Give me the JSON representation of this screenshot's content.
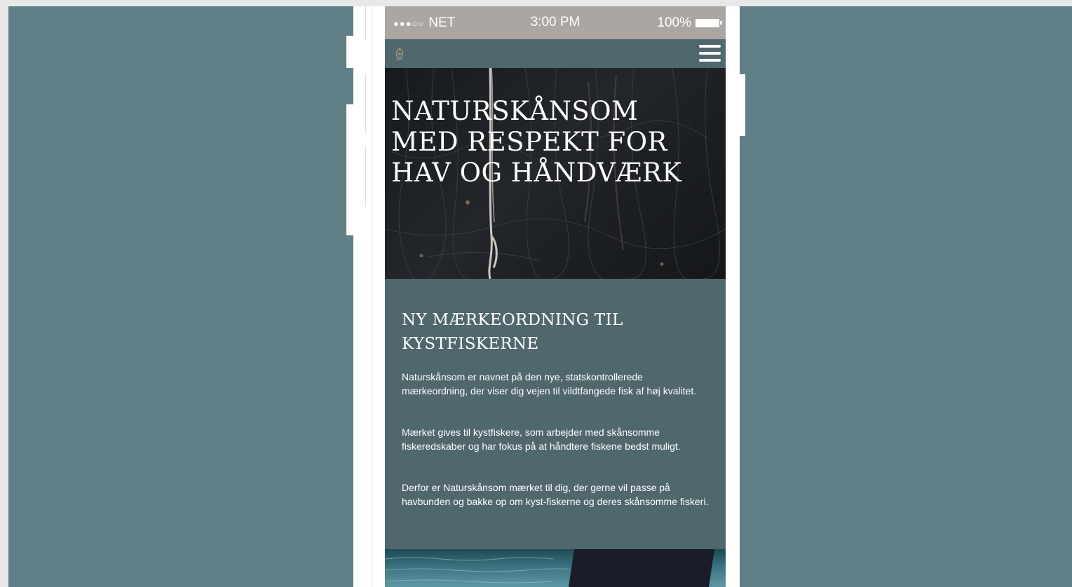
{
  "status_bar": {
    "signal": "●●●○○",
    "carrier": "NET",
    "time": "3:00 PM",
    "battery": "100%"
  },
  "navbar": {
    "logo_icon": "fish-emblem-icon",
    "menu_icon": "hamburger-menu-icon"
  },
  "hero": {
    "title": "NATURSKÅNSOM MED RESPEKT FOR HAV OG HÅNDVÆRK"
  },
  "article": {
    "heading": "NY MÆRKEORDNING TIL KYSTFISKERNE",
    "paragraphs": [
      "Naturskånsom er navnet på den nye, statskontrollerede mærkeordning, der viser dig vejen til vildtfangede fisk af høj kvalitet.",
      "Mærket gives til kystfiskere, som arbejder med skånsomme fiskeredskaber og har fokus på at håndtere fiskene bedst muligt.",
      "Derfor er Naturskånsom mærket til dig, der gerne vil passe på havbunden og bakke op om kyst-fiskerne og deres skånsomme fiskeri."
    ]
  },
  "colors": {
    "background": "#617f86",
    "phone_body": "#50676e",
    "status_bar": "#aba6a2"
  }
}
